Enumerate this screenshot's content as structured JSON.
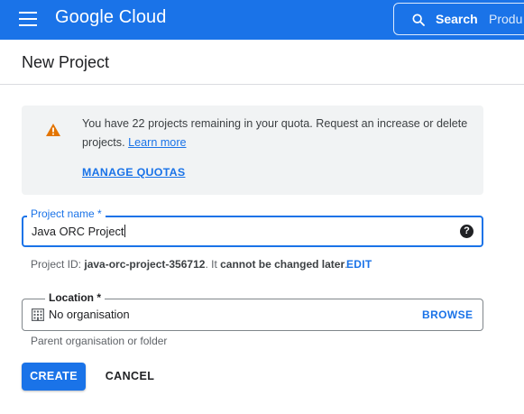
{
  "header": {
    "logo_text": "Google Cloud",
    "search_label": "Search",
    "search_placeholder": "Produ"
  },
  "page": {
    "title": "New Project"
  },
  "quota": {
    "message": "You have 22 projects remaining in your quota. Request an increase or delete projects.",
    "learn_more": "Learn more",
    "manage_quotas": "MANAGE QUOTAS"
  },
  "project_name": {
    "label": "Project name *",
    "value": "Java ORC Project",
    "help_icon_glyph": "?"
  },
  "project_id": {
    "prefix": "Project ID: ",
    "id": "java-orc-project-356712",
    "middle": ". It ",
    "bold_note": "cannot be changed later",
    "suffix": ".",
    "edit_label": "EDIT"
  },
  "location": {
    "label": "Location *",
    "value": "No organisation",
    "browse_label": "BROWSE",
    "helper": "Parent organisation or folder"
  },
  "actions": {
    "create": "CREATE",
    "cancel": "CANCEL"
  },
  "icons": {
    "menu": "menu-icon",
    "search": "search-icon",
    "warning": "warning-icon",
    "help": "help-icon",
    "building": "building-icon"
  },
  "colors": {
    "brand_blue": "#1a73e8",
    "warning_orange": "#e37400",
    "info_bg": "#f1f3f4"
  }
}
